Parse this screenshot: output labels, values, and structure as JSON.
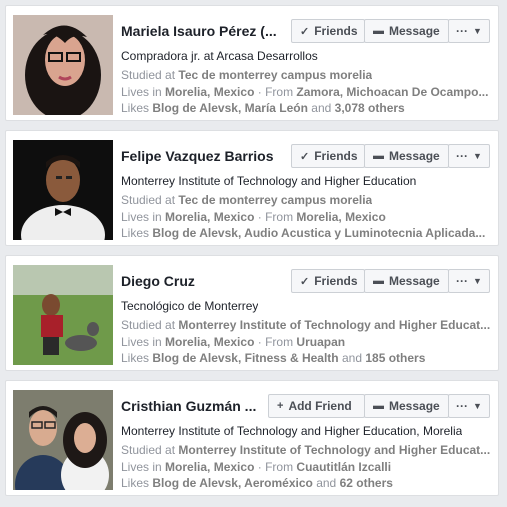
{
  "buttons": {
    "friends": "Friends",
    "add_friend": "Add Friend",
    "message": "Message",
    "more": "···"
  },
  "cards": [
    {
      "name": "Mariela Isauro Pérez (...",
      "subtitle": "Compradora jr. at Arcasa Desarrollos",
      "studied_prefix": "Studied at ",
      "studied": "Tec de monterrey campus morelia",
      "lives_prefix": "Lives in ",
      "lives": "Morelia, Mexico",
      "from_sep": " · From ",
      "from": "Zamora, Michoacan De Ocampo...",
      "likes_prefix": "Likes ",
      "likes_text": "Blog de Alevsk, María León",
      "likes_and": " and ",
      "likes_count": "3,078 others",
      "relation": "Friends"
    },
    {
      "name": "Felipe Vazquez Barrios",
      "subtitle": "Monterrey Institute of Technology and Higher Education",
      "studied_prefix": "Studied at ",
      "studied": "Tec de monterrey campus morelia",
      "lives_prefix": "Lives in ",
      "lives": "Morelia, Mexico",
      "from_sep": " · From ",
      "from": "Morelia, Mexico",
      "likes_prefix": "Likes ",
      "likes_text": "Blog de Alevsk, Audio Acustica y Luminotecnia Aplicada...",
      "likes_and": "",
      "likes_count": "",
      "relation": "Friends"
    },
    {
      "name": "Diego Cruz",
      "subtitle": "Tecnológico de Monterrey",
      "studied_prefix": "Studied at ",
      "studied": "Monterrey Institute of Technology and Higher Educat...",
      "lives_prefix": "Lives in ",
      "lives": "Morelia, Mexico",
      "from_sep": " · From ",
      "from": "Uruapan",
      "likes_prefix": "Likes ",
      "likes_text": "Blog de Alevsk, Fitness & Health",
      "likes_and": " and ",
      "likes_count": "185 others",
      "relation": "Friends"
    },
    {
      "name": "Cristhian Guzmán ...",
      "subtitle": "Monterrey Institute of Technology and Higher Education, Morelia",
      "studied_prefix": "Studied at ",
      "studied": "Monterrey Institute of Technology and Higher Educat...",
      "lives_prefix": "Lives in ",
      "lives": "Morelia, Mexico",
      "from_sep": " · From ",
      "from": "Cuautitlán Izcalli",
      "likes_prefix": "Likes ",
      "likes_text": "Blog de Alevsk, Aeroméxico",
      "likes_and": " and ",
      "likes_count": "62 others",
      "relation": "Add Friend"
    }
  ]
}
